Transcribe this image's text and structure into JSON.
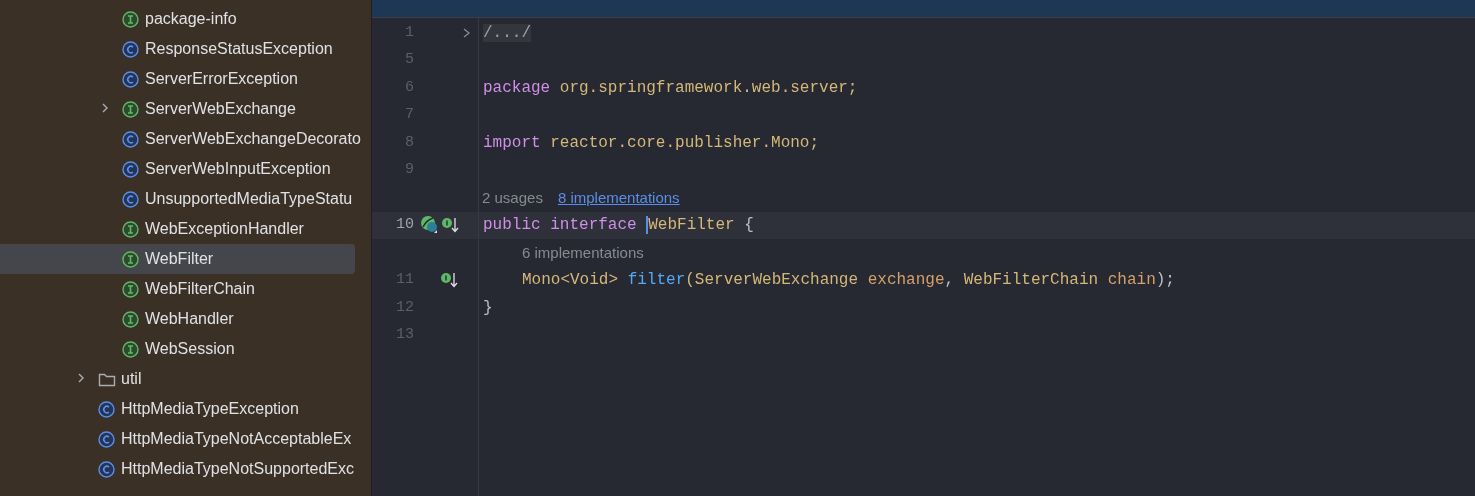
{
  "project_tree": {
    "items": [
      {
        "kind": "continuation",
        "children": [
          {
            "label": "package-info",
            "kind": "interface",
            "expandable": false,
            "selected": false
          },
          {
            "label": "ResponseStatusException",
            "kind": "class",
            "expandable": false,
            "selected": false
          },
          {
            "label": "ServerErrorException",
            "kind": "class",
            "expandable": false,
            "selected": false
          },
          {
            "label": "ServerWebExchange",
            "kind": "interface",
            "expandable": true,
            "selected": false
          },
          {
            "label": "ServerWebExchangeDecorato",
            "kind": "class",
            "expandable": false,
            "selected": false
          },
          {
            "label": "ServerWebInputException",
            "kind": "class",
            "expandable": false,
            "selected": false
          },
          {
            "label": "UnsupportedMediaTypeStatu",
            "kind": "class",
            "expandable": false,
            "selected": false
          },
          {
            "label": "WebExceptionHandler",
            "kind": "interface",
            "expandable": false,
            "selected": false
          },
          {
            "label": "WebFilter",
            "kind": "interface",
            "expandable": false,
            "selected": true
          },
          {
            "label": "WebFilterChain",
            "kind": "interface",
            "expandable": false,
            "selected": false
          },
          {
            "label": "WebHandler",
            "kind": "interface",
            "expandable": false,
            "selected": false
          },
          {
            "label": "WebSession",
            "kind": "interface",
            "expandable": false,
            "selected": false
          }
        ]
      },
      {
        "kind": "folder",
        "label": "util",
        "expandable": true,
        "selected": false
      },
      {
        "kind": "class",
        "label": "HttpMediaTypeException",
        "expandable": false,
        "selected": false
      },
      {
        "kind": "class",
        "label": "HttpMediaTypeNotAcceptableEx",
        "expandable": false,
        "selected": false
      },
      {
        "kind": "class",
        "label": "HttpMediaTypeNotSupportedExc",
        "expandable": false,
        "selected": false
      }
    ]
  },
  "editor": {
    "lines": [
      {
        "kind": "code",
        "number": "1",
        "foldable": true,
        "current": false,
        "tokens": [
          {
            "text": "/.../",
            "kind": "fold"
          }
        ]
      },
      {
        "kind": "code",
        "number": "5",
        "foldable": false,
        "current": false
      },
      {
        "kind": "code",
        "number": "6",
        "foldable": false,
        "current": false,
        "tokens": [
          {
            "text": "package ",
            "kind": "keyword"
          },
          {
            "text": "org.springframework.web.server;",
            "kind": "text"
          }
        ]
      },
      {
        "kind": "code",
        "number": "7",
        "foldable": false,
        "current": false
      },
      {
        "kind": "code",
        "number": "8",
        "foldable": false,
        "current": false,
        "tokens": [
          {
            "text": "import ",
            "kind": "keyword"
          },
          {
            "text": "reactor.core.publisher.Mono;",
            "kind": "text"
          }
        ]
      },
      {
        "kind": "code",
        "number": "9",
        "foldable": false,
        "current": false
      },
      {
        "kind": "hint",
        "indent": false,
        "usages": "2 usages",
        "link": "8 implementations"
      },
      {
        "kind": "code",
        "number": "10",
        "foldable": false,
        "current": true,
        "gutter": [
          {
            "kind": "bean"
          },
          {
            "kind": "implemented"
          }
        ],
        "tokens": [
          {
            "text": "public ",
            "kind": "keyword"
          },
          {
            "text": "interface ",
            "kind": "keyword"
          },
          {
            "text": "WebFilter",
            "kind": "type",
            "caret": true
          },
          {
            "text": " {",
            "kind": "punct"
          }
        ]
      },
      {
        "kind": "hint",
        "indent": true,
        "usages": "6 implementations"
      },
      {
        "kind": "code",
        "number": "11",
        "foldable": false,
        "current": false,
        "gutter": [
          {
            "kind": "implemented"
          }
        ],
        "indent": true,
        "tokens": [
          {
            "text": "Mono<Void> ",
            "kind": "type"
          },
          {
            "text": "filter",
            "kind": "method"
          },
          {
            "text": "(ServerWebExchange ",
            "kind": "type"
          },
          {
            "text": "exchange",
            "kind": "param"
          },
          {
            "text": ", ",
            "kind": "punct"
          },
          {
            "text": "WebFilterChain ",
            "kind": "type"
          },
          {
            "text": "chain",
            "kind": "param"
          },
          {
            "text": ");",
            "kind": "punct"
          }
        ]
      },
      {
        "kind": "code",
        "number": "12",
        "foldable": false,
        "current": false,
        "tokens": [
          {
            "text": "}",
            "kind": "punct"
          }
        ]
      },
      {
        "kind": "code",
        "number": "13",
        "foldable": false,
        "current": false
      }
    ]
  }
}
